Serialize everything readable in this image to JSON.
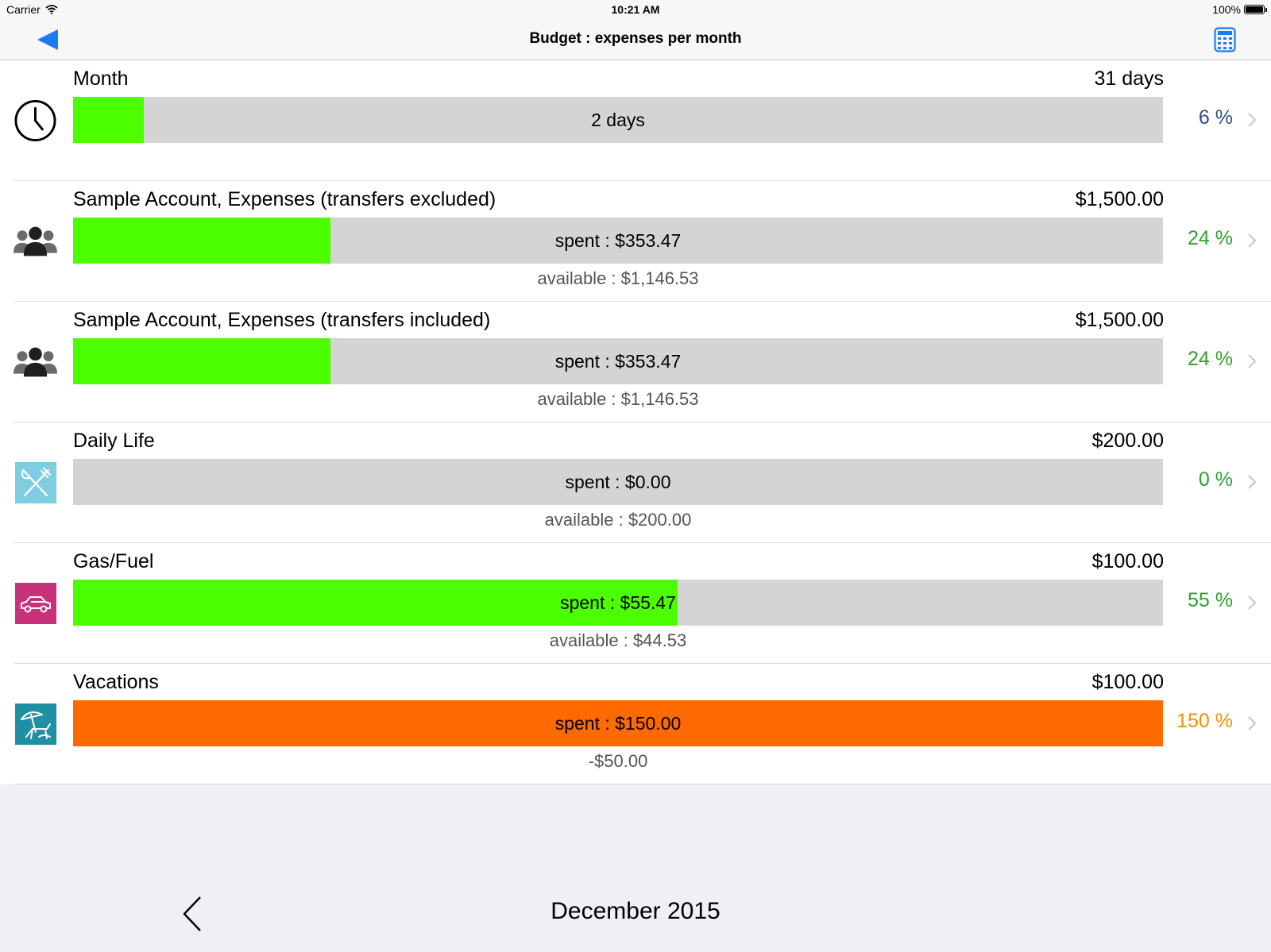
{
  "status_bar": {
    "carrier": "Carrier",
    "time": "10:21 AM",
    "battery": "100%"
  },
  "nav": {
    "title": "Budget : expenses per month",
    "back_icon": "back-triangle-icon",
    "right_icon": "calculator-icon",
    "accent_color": "#1a7cf3"
  },
  "colors": {
    "green": "#4cff00",
    "orange": "#ff6a00",
    "track": "#d4d4d4",
    "pct_green": "#2e9f2e",
    "pct_blue": "#2f4d8a",
    "pct_orange": "#f29100"
  },
  "rows": [
    {
      "icon": "clock-icon",
      "name": "Month",
      "budget": "31 days",
      "bar_label": "2 days",
      "sub": "",
      "pct": "6 %",
      "fill_percent": 6.5,
      "fill_color": "#4cff00",
      "pct_color": "#2f4d8a"
    },
    {
      "icon": "people-icon",
      "name": "Sample Account, Expenses (transfers excluded)",
      "budget": "$1,500.00",
      "bar_label": "spent : $353.47",
      "sub": "available : $1,146.53",
      "pct": "24 %",
      "fill_percent": 23.6,
      "fill_color": "#4cff00",
      "pct_color": "#2e9f2e"
    },
    {
      "icon": "people-icon",
      "name": "Sample Account, Expenses (transfers included)",
      "budget": "$1,500.00",
      "bar_label": "spent : $353.47",
      "sub": "available : $1,146.53",
      "pct": "24 %",
      "fill_percent": 23.6,
      "fill_color": "#4cff00",
      "pct_color": "#2e9f2e"
    },
    {
      "icon": "fork-knife-icon",
      "name": "Daily Life",
      "budget": "$200.00",
      "bar_label": "spent : $0.00",
      "sub": "available : $200.00",
      "pct": "0 %",
      "fill_percent": 0,
      "fill_color": "#4cff00",
      "pct_color": "#2e9f2e"
    },
    {
      "icon": "car-icon",
      "name": "Gas/Fuel",
      "budget": "$100.00",
      "bar_label": "spent : $55.47",
      "sub": "available : $44.53",
      "pct": "55 %",
      "fill_percent": 55.5,
      "fill_color": "#4cff00",
      "pct_color": "#2e9f2e"
    },
    {
      "icon": "beach-umbrella-icon",
      "name": "Vacations",
      "budget": "$100.00",
      "bar_label": "spent : $150.00",
      "sub": "-$50.00",
      "pct": "150 %",
      "fill_percent": 100,
      "fill_color": "#ff6a00",
      "pct_color": "#f29100"
    }
  ],
  "footer": {
    "month": "December 2015",
    "prev_icon": "chevron-left-icon"
  }
}
